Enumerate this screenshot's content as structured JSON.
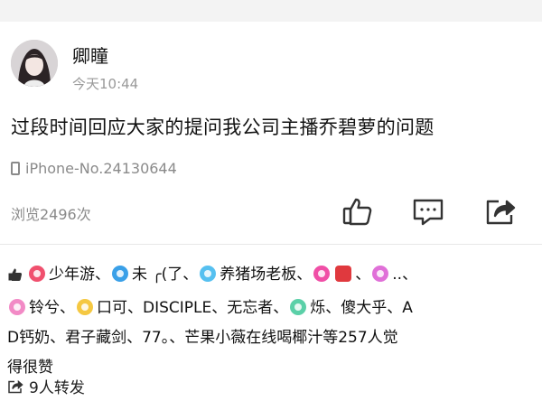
{
  "post": {
    "author": "卿瞳",
    "time": "今天10:44",
    "text": "过段时间回应大家的提问我公司主播乔碧萝的问题",
    "device": "iPhone-No.24130644",
    "views": "浏览2496次"
  },
  "likes": {
    "users": [
      {
        "name": "少年游",
        "badge_color": "#f0506e"
      },
      {
        "name": "未 ╭(了",
        "badge_color": "#3aa0e8"
      },
      {
        "name": "养猪场老板",
        "badge_color": "#56c0f0"
      },
      {
        "name": "",
        "badge_color": "#f04fa6"
      },
      {
        "name": "",
        "badge_color": "#f5a0c8",
        "emoji": "👺"
      },
      {
        "name": "..",
        "badge_color": "#e070d8"
      },
      {
        "name": "铃兮",
        "badge_color": "#f28ac6"
      },
      {
        "name": "口可",
        "badge_color": "#f5c842"
      },
      {
        "name": "DISCIPLE",
        "badge_color": ""
      },
      {
        "name": "无忘者",
        "badge_color": ""
      },
      {
        "name": "烁",
        "badge_color": "#5bd0a8"
      },
      {
        "name": "傻大乎",
        "badge_color": ""
      },
      {
        "name": "AD钙奶",
        "badge_color": ""
      },
      {
        "name": "君子藏剑",
        "badge_color": ""
      },
      {
        "name": "77。",
        "badge_color": ""
      }
    ],
    "line1": [
      "少年游",
      "未 ╭(了",
      "养猪场老板",
      "..",
      "铃兮",
      "口可"
    ],
    "text_line2": "DISCIPLE、无忘者、",
    "text_line2b": "烁、傻大乎、A",
    "text_line3": "D钙奶、君子藏剑、77。、芒果小薇在线喝椰汁等257人觉",
    "text_line4": "得很赞"
  },
  "reposts": "9人转发",
  "colors": {
    "text": "#111111",
    "muted": "#8a8a8a",
    "accent": "#3a7ae0"
  },
  "icons": [
    "thumbs-up-icon",
    "comment-icon",
    "share-icon",
    "phone-icon",
    "repost-icon"
  ]
}
